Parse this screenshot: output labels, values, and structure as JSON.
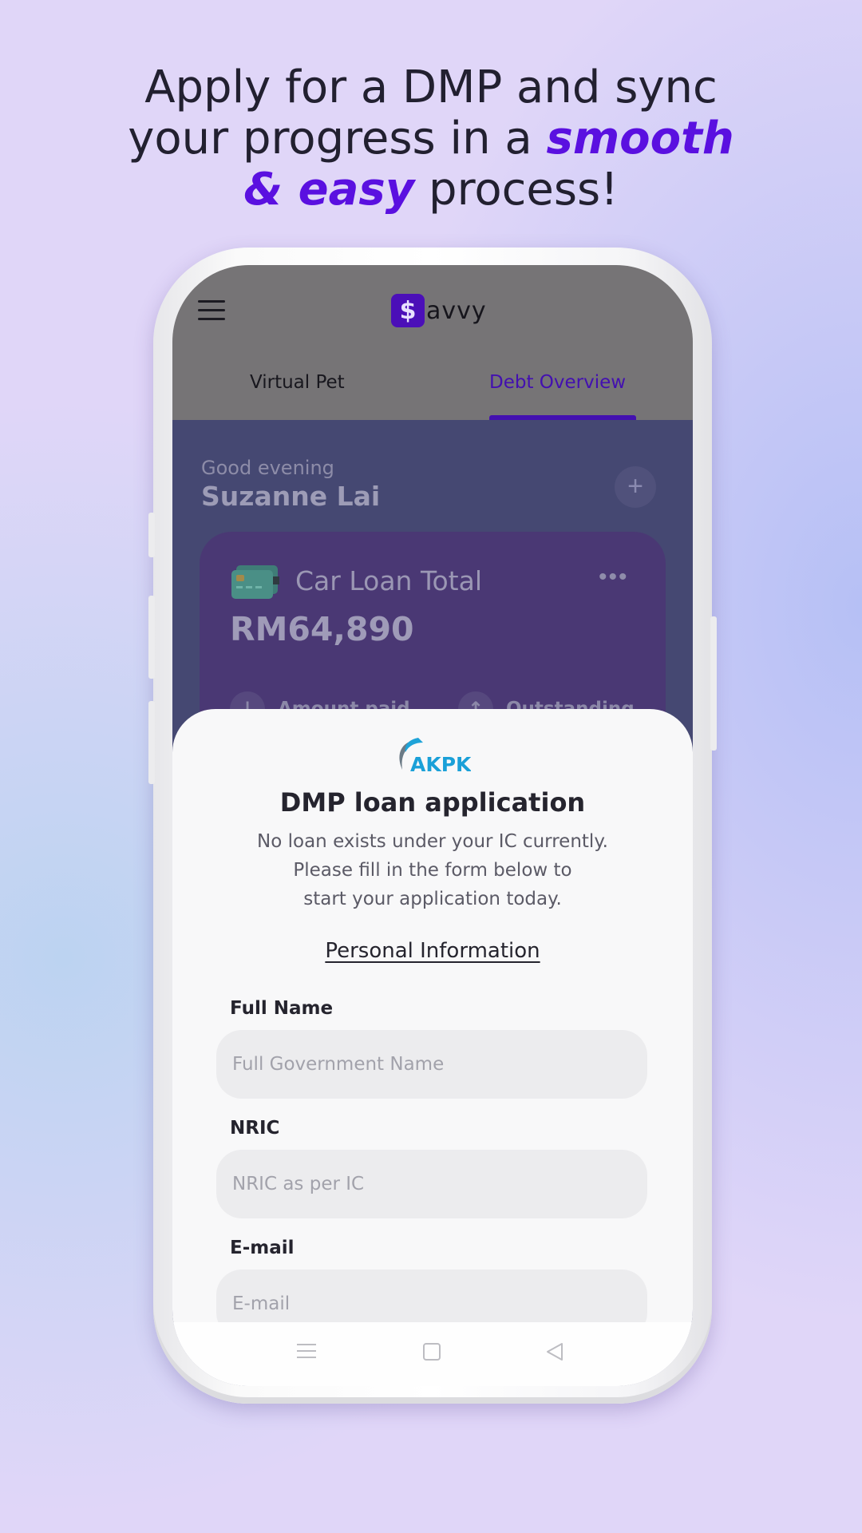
{
  "headline": {
    "line1": "Apply for a DMP and sync",
    "line2_start": "your progress in a ",
    "line2_emph": "smooth",
    "line3_emph": "& easy",
    "line3_end": " process!"
  },
  "app": {
    "logo_letter": "$",
    "logo_text": "avvy",
    "tabs": [
      {
        "label": "Virtual Pet",
        "active": false
      },
      {
        "label": "Debt Overview",
        "active": true
      }
    ],
    "greeting": "Good evening",
    "user_name": "Suzanne Lai",
    "add_symbol": "+",
    "card": {
      "title": "Car Loan Total",
      "amount": "RM64,890",
      "more_symbol": "•••",
      "stats": [
        {
          "label": "Amount paid",
          "icon": "arrow-down-icon",
          "glyph": "↓"
        },
        {
          "label": "Outstanding",
          "icon": "arrow-up-icon",
          "glyph": "↑"
        }
      ]
    }
  },
  "sheet": {
    "logo_text": "AKPK",
    "title": "DMP loan application",
    "description_lines": [
      "No loan exists under your IC currently.",
      "Please fill in the form below to",
      "start your application today."
    ],
    "section_title": "Personal Information",
    "fields": [
      {
        "label": "Full Name",
        "placeholder": "Full Government Name"
      },
      {
        "label": "NRIC",
        "placeholder": "NRIC as per IC"
      },
      {
        "label": "E-mail",
        "placeholder": "E-mail"
      }
    ]
  },
  "colors": {
    "accent": "#5a10e0",
    "brand": "#4b0fb8",
    "background": "#e0d6f8"
  }
}
